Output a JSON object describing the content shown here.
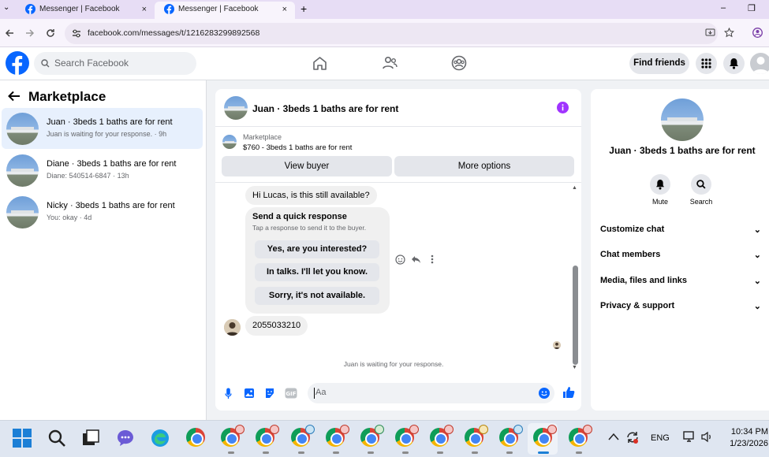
{
  "browser": {
    "tabs": [
      {
        "title": "Messenger | Facebook",
        "close": "×"
      },
      {
        "title": "Messenger | Facebook",
        "close": "×"
      }
    ],
    "new_tab": "+",
    "window_minimize": "–",
    "window_restore": "❐",
    "url": "facebook.com/messages/t/1216283299892568"
  },
  "header": {
    "search_placeholder": "Search Facebook",
    "find_friends": "Find friends",
    "brand_color": "#0866ff"
  },
  "left": {
    "title": "Marketplace",
    "conversations": [
      {
        "title": "Juan · 3beds 1 baths are for rent",
        "subtitle": "Juan is waiting for your response. · 9h",
        "selected": true
      },
      {
        "title": "Diane · 3beds 1 baths are for rent",
        "subtitle": "Diane: 540514-6847 · 13h",
        "selected": false
      },
      {
        "title": "Nicky · 3beds 1 baths are for rent",
        "subtitle": "You: okay · 4d",
        "selected": false
      }
    ]
  },
  "chat": {
    "title": "Juan · 3beds 1 baths are for rent",
    "listing_source": "Marketplace",
    "listing_title": "$760 - 3beds 1 baths are for rent",
    "view_buyer": "View buyer",
    "more_options": "More options",
    "messages": {
      "first": "Hi Lucas, is this still available?",
      "quick_title": "Send a quick response",
      "quick_subtitle": "Tap a response to send it to the buyer.",
      "quick_responses": [
        "Yes, are you interested?",
        "In talks. I'll let you know.",
        "Sorry, it's not available."
      ],
      "number": "2055033210"
    },
    "status": "Juan is waiting for your response.",
    "composer_placeholder": "Aa"
  },
  "right": {
    "title": "Juan · 3beds 1 baths are for rent",
    "mute": "Mute",
    "search": "Search",
    "sections": [
      "Customize chat",
      "Chat members",
      "Media, files and links",
      "Privacy & support"
    ]
  },
  "taskbar": {
    "language": "ENG",
    "time": "10:34 PM",
    "date": "1/23/2026"
  }
}
